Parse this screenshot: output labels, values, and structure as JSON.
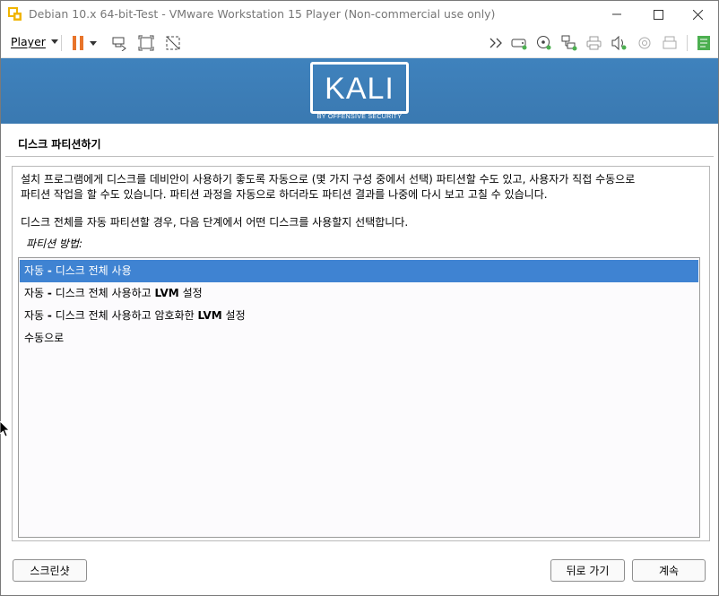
{
  "window": {
    "title": "Debian 10.x 64-bit-Test - VMware Workstation 15 Player (Non-commercial use only)"
  },
  "toolbar": {
    "player_label": "Player",
    "icons": [
      "pause-icon",
      "send-ctrl-alt-del-icon",
      "fit-guest-icon",
      "unity-icon",
      "more-icon",
      "hdd-icon",
      "cd-icon",
      "network-icon",
      "printer-icon",
      "sound-icon",
      "usb-icon",
      "floppy-icon",
      "notes-icon"
    ]
  },
  "banner": {
    "logo_text": "KALI",
    "logo_sub": "BY OFFENSIVE SECURITY"
  },
  "installer": {
    "title": "디스크 파티션하기",
    "desc_line1": "설치 프로그램에게 디스크를 데비안이 사용하기 좋도록 자동으로 (몇 가지 구성 중에서 선택) 파티션할 수도 있고, 사용자가 직접 수동으로",
    "desc_line2": "파티션 작업을 할 수도 있습니다. 파티션 과정을 자동으로 하더라도 파티션 결과를 나중에 다시 보고 고칠 수 있습니다.",
    "desc_line3": "디스크 전체를 자동 파티션할 경우, 다음 단계에서 어떤 디스크를 사용할지 선택합니다.",
    "method_label": "파티션 방법:",
    "options": [
      {
        "prefix": "자동 ",
        "dash": "-",
        "text": " 디스크 전체 사용",
        "lvm": "",
        "suffix": ""
      },
      {
        "prefix": "자동 ",
        "dash": "-",
        "text": " 디스크 전체 사용하고 ",
        "lvm": "LVM",
        "suffix": " 설정"
      },
      {
        "prefix": "자동 ",
        "dash": "-",
        "text": " 디스크 전체 사용하고 암호화한 ",
        "lvm": "LVM",
        "suffix": " 설정"
      },
      {
        "prefix": "수동으로",
        "dash": "",
        "text": "",
        "lvm": "",
        "suffix": ""
      }
    ],
    "selected_index": 0
  },
  "buttons": {
    "screenshot": "스크린샷",
    "back": "뒤로 가기",
    "continue": "계속"
  },
  "colors": {
    "banner": "#3e7fb8",
    "selection": "#3f83d2",
    "pause": "#e8742a"
  }
}
